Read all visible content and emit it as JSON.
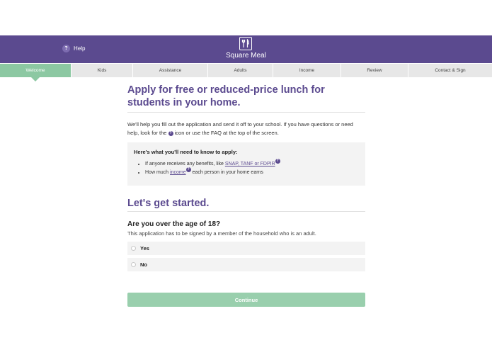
{
  "header": {
    "help_label": "Help",
    "help_icon_glyph": "?",
    "brand": "Square Meal",
    "logo_icon": "fork-knife-icon",
    "bg_color": "#5b4a8f"
  },
  "tabs": [
    {
      "label": "Welcome",
      "active": true
    },
    {
      "label": "Kids",
      "active": false
    },
    {
      "label": "Assistance",
      "active": false
    },
    {
      "label": "Adults",
      "active": false
    },
    {
      "label": "Income",
      "active": false
    },
    {
      "label": "Review",
      "active": false
    },
    {
      "label": "Contact & Sign",
      "active": false
    }
  ],
  "main": {
    "title": "Apply for free or reduced-price lunch for students in your home.",
    "intro_part1": "We'll help you fill out the application and send it off to your school. If you have questions or need help, look for the ",
    "intro_icon_glyph": "?",
    "intro_part2": " icon or use the FAQ at the top of the screen.",
    "info_box": {
      "title": "Here's what you'll need to know to apply:",
      "item1_prefix": "If anyone receives any benefits, like ",
      "item1_link": "SNAP, TANF or FDPIR",
      "item2_prefix": "How much ",
      "item2_link": "income",
      "item2_suffix": " each person in your home earns",
      "sup_glyph": "?"
    },
    "section_title": "Let's get started.",
    "question": "Are you over the age of 18?",
    "question_sub": "This application has to be signed by a member of the household who is an adult.",
    "options": [
      "Yes",
      "No"
    ],
    "continue_label": "Continue"
  },
  "colors": {
    "accent": "#5b4a8f",
    "active_tab": "#8cc8a2",
    "continue_button": "#99cfad"
  }
}
